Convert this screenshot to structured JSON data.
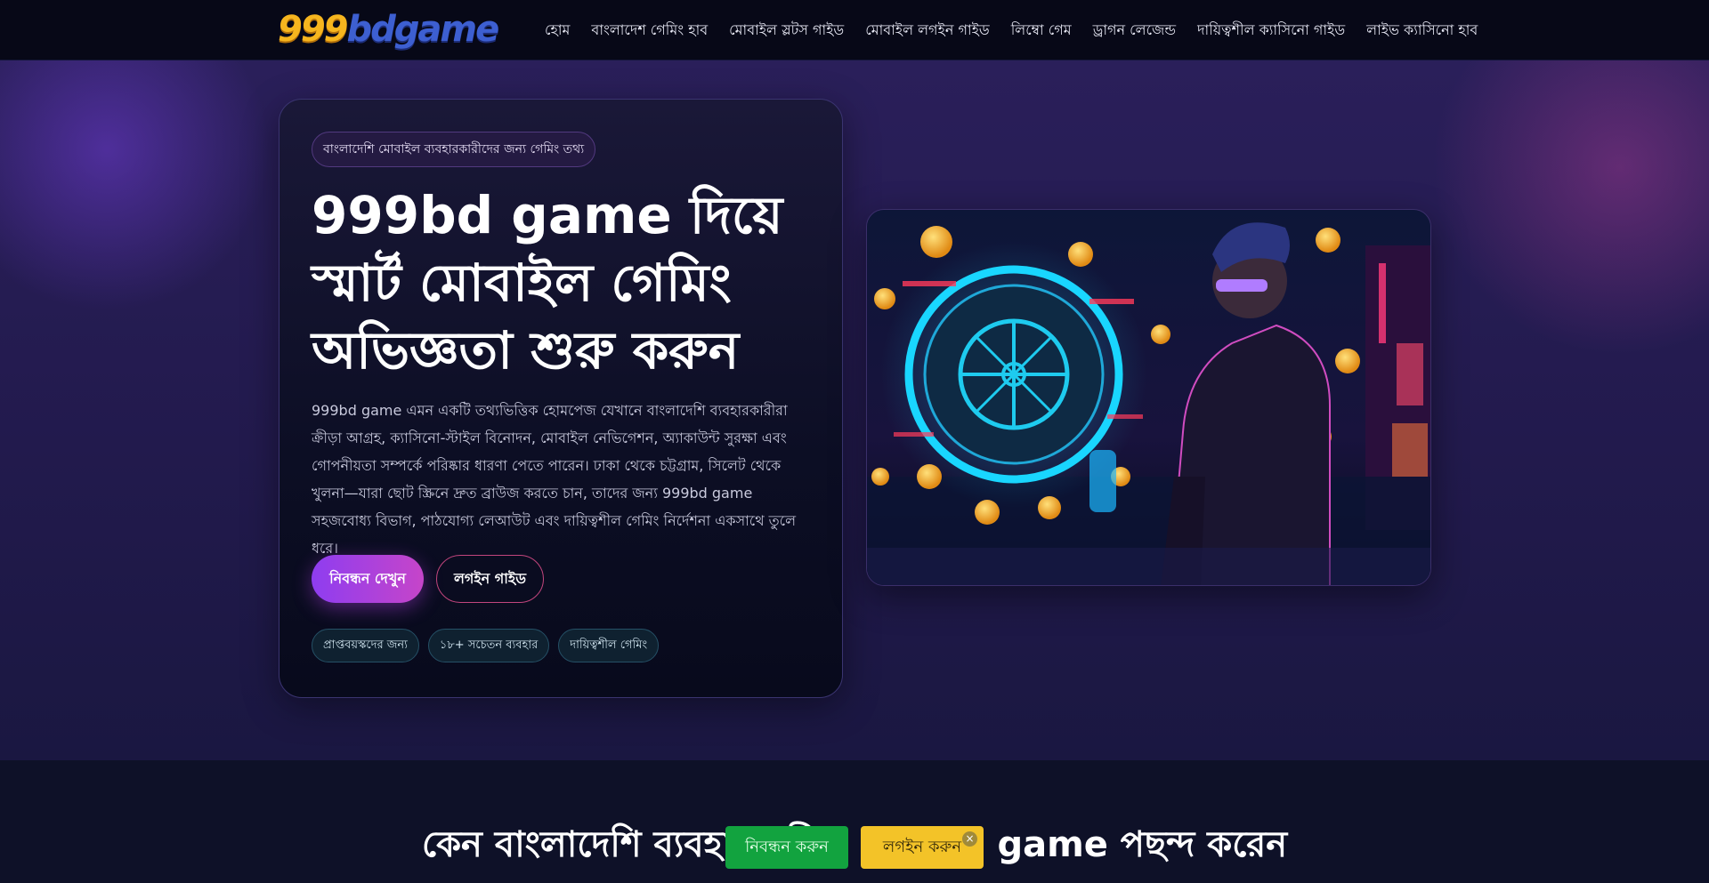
{
  "header": {
    "logo": {
      "part1": "999",
      "part2": "bdgame"
    },
    "nav": [
      "হোম",
      "বাংলাদেশ গেমিং হাব",
      "মোবাইল স্লটস গাইড",
      "মোবাইল লগইন গাইড",
      "লিম্বো গেম",
      "ড্রাগন লেজেন্ড",
      "দায়িত্বশীল ক্যাসিনো গাইড",
      "লাইভ ক্যাসিনো হাব"
    ]
  },
  "hero": {
    "badge": "বাংলাদেশি মোবাইল ব্যবহারকারীদের জন্য গেমিং তথ্য",
    "title": "999bd game দিয়ে স্মার্ট মোবাইল গেমিং অভিজ্ঞতা শুরু করুন",
    "description": "999bd game এমন একটি তথ্যভিত্তিক হোমপেজ যেখানে বাংলাদেশি ব্যবহারকারীরা ক্রীড়া আগ্রহ, ক্যাসিনো-স্টাইল বিনোদন, মোবাইল নেভিগেশন, অ্যাকাউন্ট সুরক্ষা এবং গোপনীয়তা সম্পর্কে পরিষ্কার ধারণা পেতে পারেন। ঢাকা থেকে চট্টগ্রাম, সিলেট থেকে খুলনা—যারা ছোট স্ক্রিনে দ্রুত ব্রাউজ করতে চান, তাদের জন্য 999bd game সহজবোধ্য বিভাগ, পাঠযোগ্য লেআউট এবং দায়িত্বশীল গেমিং নির্দেশনা একসাথে তুলে ধরে।",
    "primary_button": "নিবন্ধন দেখুন",
    "secondary_button": "লগইন গাইড",
    "chips": [
      "প্রাপ্তবয়স্কদের জন্য",
      "১৮+ সচেতন ব্যবহার",
      "দায়িত্বশীল গেমিং"
    ]
  },
  "section": {
    "title": "কেন বাংলাদেশি ব্যবহারকারীরা 999bd game পছন্দ করেন"
  },
  "sticky": {
    "left_label": "নিবন্ধন করুন",
    "right_label": "লগইন করুন",
    "close": "×"
  },
  "colors": {
    "accent_purple": "#8e3df0",
    "accent_pink": "#c645c9",
    "logo_gold": "#f6b51e",
    "logo_blue": "#3d5fd1",
    "sticky_green": "#12a33f",
    "sticky_yellow": "#f3c328"
  }
}
